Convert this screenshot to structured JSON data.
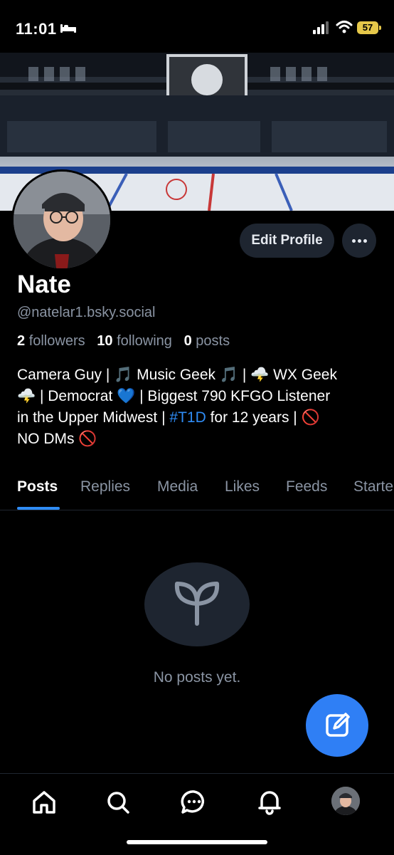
{
  "status_bar": {
    "time": "11:01",
    "battery": "57"
  },
  "profile": {
    "display_name": "Nate",
    "handle": "@natelar1.bsky.social",
    "edit_button": "Edit Profile",
    "stats": {
      "followers_count": "2",
      "followers_label": "followers",
      "following_count": "10",
      "following_label": "following",
      "posts_count": "0",
      "posts_label": "posts"
    },
    "bio": {
      "line1": "Camera Guy | 🎵 Music Geek 🎵 | 🌩️ WX Geek",
      "line2": "🌩️ | Democrat 💙 | Biggest 790 KFGO Listener",
      "line3_before": "in the Upper Midwest | ",
      "hashtag": "#T1D",
      "line3_after": " for 12 years | 🚫",
      "line4": "NO DMs 🚫"
    }
  },
  "tabs": [
    {
      "label": "Posts"
    },
    {
      "label": "Replies"
    },
    {
      "label": "Media"
    },
    {
      "label": "Likes"
    },
    {
      "label": "Feeds"
    },
    {
      "label": "Starte"
    }
  ],
  "empty_state": {
    "icon": "seedling-icon",
    "text": "No posts yet."
  },
  "colors": {
    "accent": "#2f8cf5",
    "fab": "#2f7ff5",
    "muted_text": "#8a94a3",
    "surface": "#1e2530"
  }
}
